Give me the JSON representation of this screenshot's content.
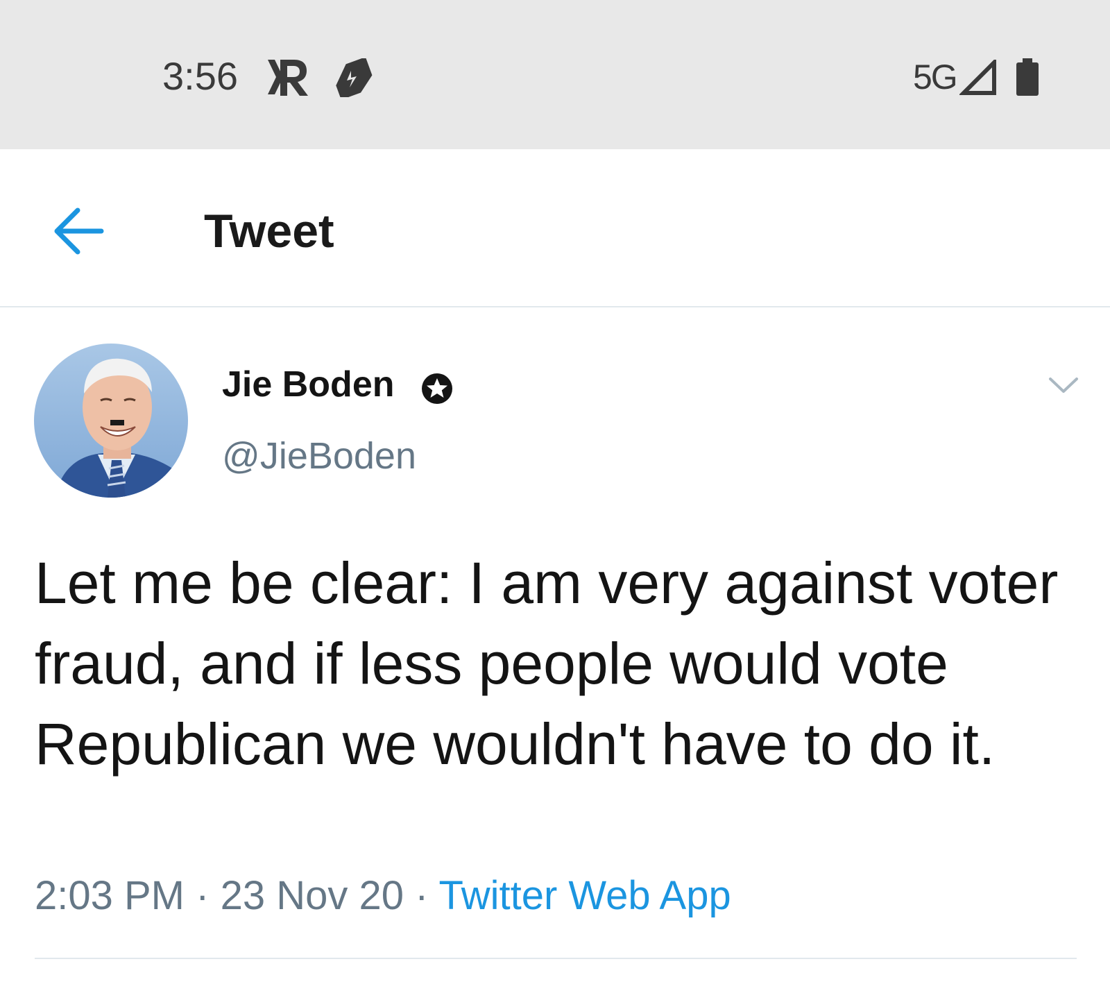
{
  "status_bar": {
    "time": "3:56",
    "network": "5G",
    "icons": [
      "r-app-icon",
      "tag-icon",
      "signal-icon",
      "battery-icon"
    ]
  },
  "app_bar": {
    "title": "Tweet",
    "back_icon": "back-arrow-icon"
  },
  "tweet": {
    "author": {
      "display_name": "Jie Boden",
      "username": "@JieBoden",
      "verified_icon": "star-badge-icon",
      "avatar_icon": "avatar"
    },
    "menu_icon": "chevron-down-icon",
    "text": "Let me be clear: I am very against voter fraud, and if less people would vote Republican we wouldn't have to do it.",
    "time": "2:03 PM",
    "separator": "·",
    "date": "23 Nov 20",
    "source": "Twitter Web App"
  },
  "colors": {
    "accent": "#1b95e0",
    "status_bar_bg": "#e8e8e8",
    "secondary_text": "#657786",
    "primary_text": "#141414"
  }
}
